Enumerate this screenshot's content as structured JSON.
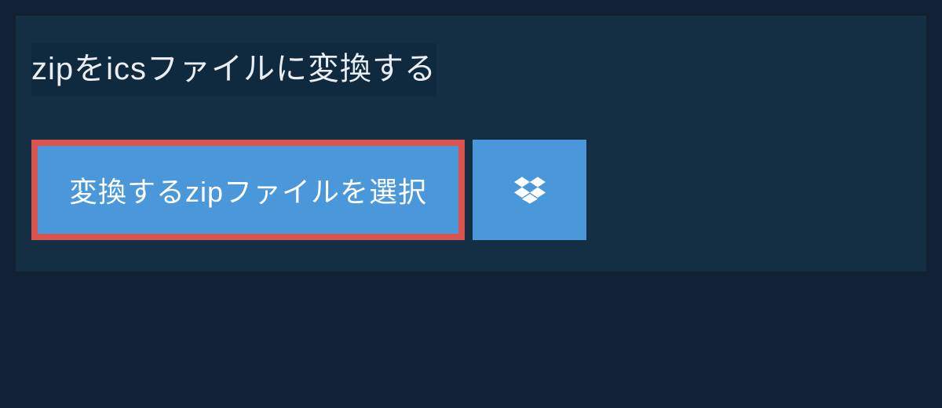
{
  "heading": "zipをicsファイルに変換する",
  "buttons": {
    "select_file_label": "変換するzipファイルを選択"
  },
  "colors": {
    "page_bg": "#0f2133",
    "panel_bg": "#142e43",
    "heading_bg": "#0f2a3e",
    "button_bg": "#4a97d9",
    "highlight_border": "#d9544f",
    "text_primary": "#e8eef3",
    "text_on_button": "#ffffff"
  }
}
